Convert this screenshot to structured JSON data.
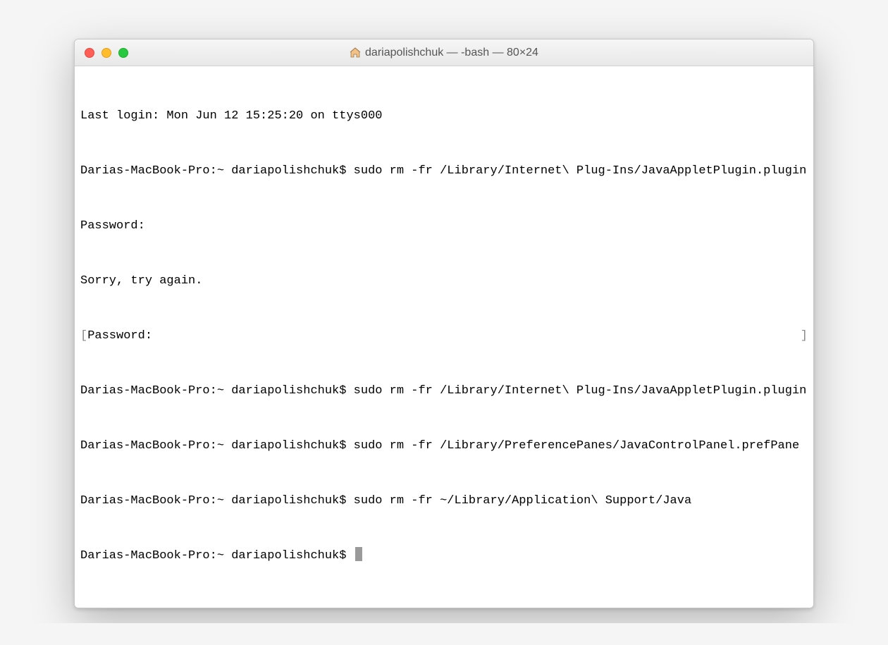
{
  "window": {
    "title": "dariapolishchuk — -bash — 80×24"
  },
  "terminal": {
    "lines": [
      "Last login: Mon Jun 12 15:25:20 on ttys000",
      "Darias-MacBook-Pro:~ dariapolishchuk$ sudo rm -fr /Library/Internet\\ Plug-Ins/JavaAppletPlugin.plugin",
      "Password:",
      "Sorry, try again.",
      "Password:",
      "Darias-MacBook-Pro:~ dariapolishchuk$ sudo rm -fr /Library/Internet\\ Plug-Ins/JavaAppletPlugin.plugin",
      "Darias-MacBook-Pro:~ dariapolishchuk$ sudo rm -fr /Library/PreferencePanes/JavaControlPanel.prefPane",
      "Darias-MacBook-Pro:~ dariapolishchuk$ sudo rm -fr ~/Library/Application\\ Support/Java",
      "Darias-MacBook-Pro:~ dariapolishchuk$ "
    ],
    "bracket_line_index": 4
  }
}
